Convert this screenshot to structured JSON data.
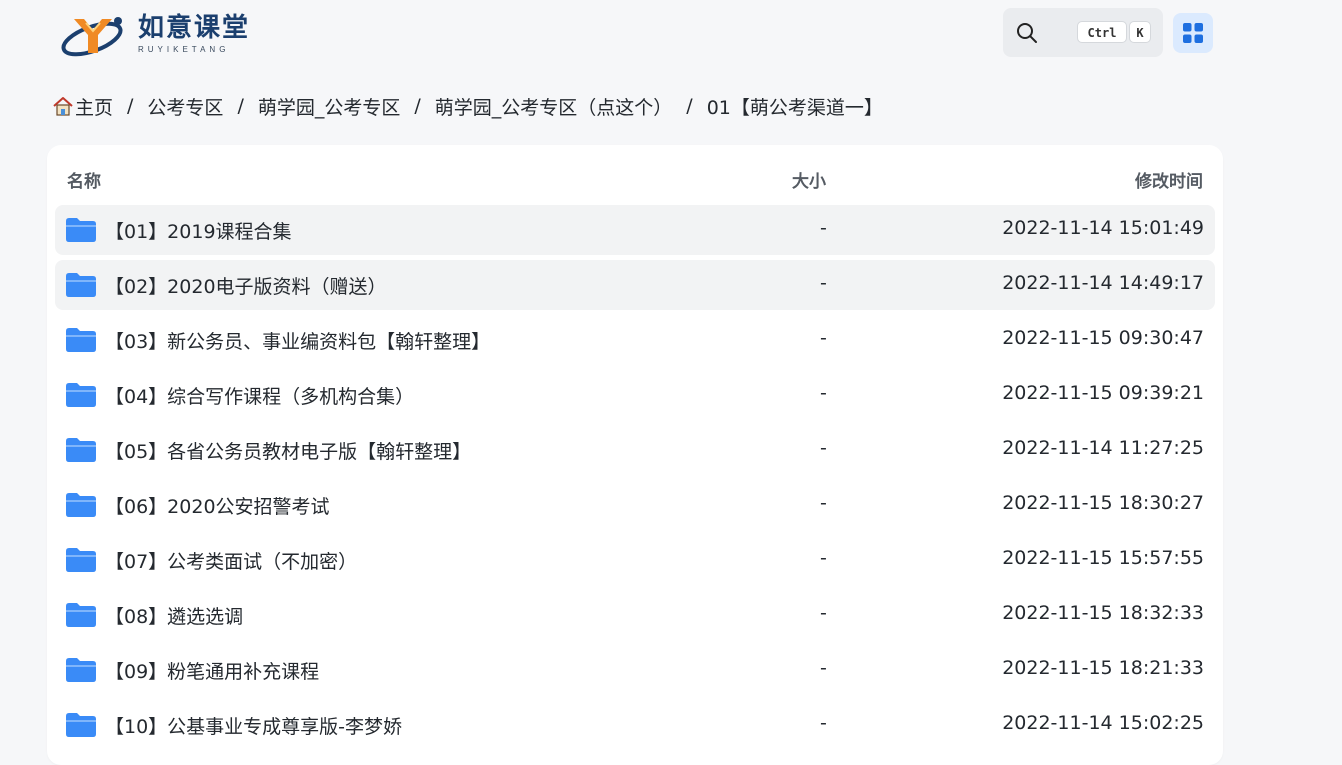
{
  "header": {
    "logo_cn": "如意课堂",
    "logo_en": "RUYIKETANG",
    "search": {
      "icon": "search-icon",
      "shortcut_ctrl": "Ctrl",
      "shortcut_key": "K"
    },
    "apps_icon": "grid-icon"
  },
  "breadcrumb": {
    "home_icon": "home-icon",
    "items": [
      "主页",
      "公考专区",
      "萌学园_公考专区",
      "萌学园_公考专区（点这个）",
      "01【萌公考渠道一】"
    ],
    "separator": "/"
  },
  "table": {
    "columns": {
      "name": "名称",
      "size": "大小",
      "time": "修改时间"
    },
    "row_icon": "folder-icon",
    "rows": [
      {
        "name": "【01】2019课程合集",
        "size": "-",
        "time": "2022-11-14 15:01:49"
      },
      {
        "name": "【02】2020电子版资料（赠送）",
        "size": "-",
        "time": "2022-11-14 14:49:17"
      },
      {
        "name": "【03】新公务员、事业编资料包【翰轩整理】",
        "size": "-",
        "time": "2022-11-15 09:30:47"
      },
      {
        "name": "【04】综合写作课程（多机构合集）",
        "size": "-",
        "time": "2022-11-15 09:39:21"
      },
      {
        "name": "【05】各省公务员教材电子版【翰轩整理】",
        "size": "-",
        "time": "2022-11-14 11:27:25"
      },
      {
        "name": "【06】2020公安招警考试",
        "size": "-",
        "time": "2022-11-15 18:30:27"
      },
      {
        "name": "【07】公考类面试（不加密）",
        "size": "-",
        "time": "2022-11-15 15:57:55"
      },
      {
        "name": "【08】遴选选调",
        "size": "-",
        "time": "2022-11-15 18:32:33"
      },
      {
        "name": "【09】粉笔通用补充课程",
        "size": "-",
        "time": "2022-11-15 18:21:33"
      },
      {
        "name": "【10】公基事业专成尊享版-李梦娇",
        "size": "-",
        "time": "2022-11-14 15:02:25"
      }
    ]
  },
  "colors": {
    "accent": "#2f7df6",
    "folder": "#3a8bf7",
    "apps_bg": "#dbeafe"
  }
}
